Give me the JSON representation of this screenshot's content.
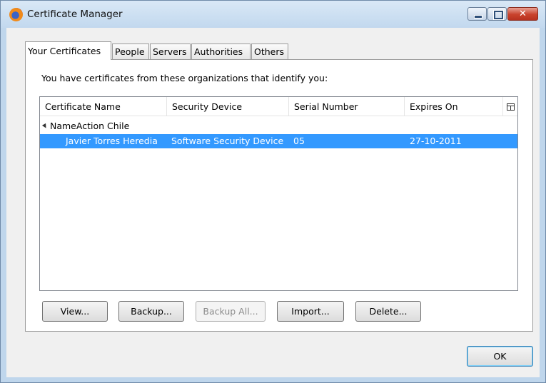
{
  "window": {
    "title": "Certificate Manager",
    "icon": "firefox-icon"
  },
  "tabs": [
    {
      "label": "Your Certificates",
      "active": true
    },
    {
      "label": "People",
      "active": false
    },
    {
      "label": "Servers",
      "active": false
    },
    {
      "label": "Authorities",
      "active": false
    },
    {
      "label": "Others",
      "active": false
    }
  ],
  "panel": {
    "intro": "You have certificates from these organizations that identify you:"
  },
  "table": {
    "columns": [
      "Certificate Name",
      "Security Device",
      "Serial Number",
      "Expires On"
    ],
    "group": "NameAction Chile",
    "rows": [
      {
        "name": "Javier Torres Heredia",
        "device": "Software Security Device",
        "serial": "05",
        "expires": "27-10-2011",
        "selected": true
      }
    ]
  },
  "buttons": {
    "view": "View...",
    "backup": "Backup...",
    "backup_all": "Backup All...",
    "import": "Import...",
    "delete": "Delete...",
    "ok": "OK"
  },
  "colors": {
    "selection": "#3399ff",
    "titlebar": "#c8dcf0"
  }
}
